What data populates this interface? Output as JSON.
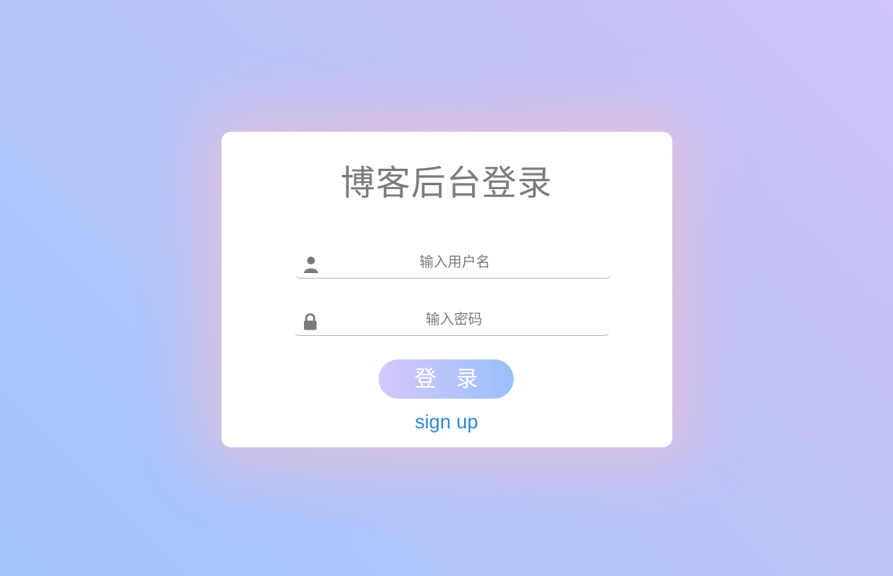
{
  "login": {
    "title": "博客后台登录",
    "username": {
      "placeholder": "输入用户名",
      "icon": "user-icon",
      "value": ""
    },
    "password": {
      "placeholder": "输入密码",
      "icon": "lock-icon",
      "value": ""
    },
    "login_button_label": "登 录",
    "signup_link_label": "sign up"
  },
  "colors": {
    "title_text": "#7c7c7c",
    "icon": "#7a7a7a",
    "link": "#2b8bd0",
    "button_gradient_start": "#d6c8fb",
    "button_gradient_end": "#99c0fb",
    "card_background": "#ffffff"
  }
}
